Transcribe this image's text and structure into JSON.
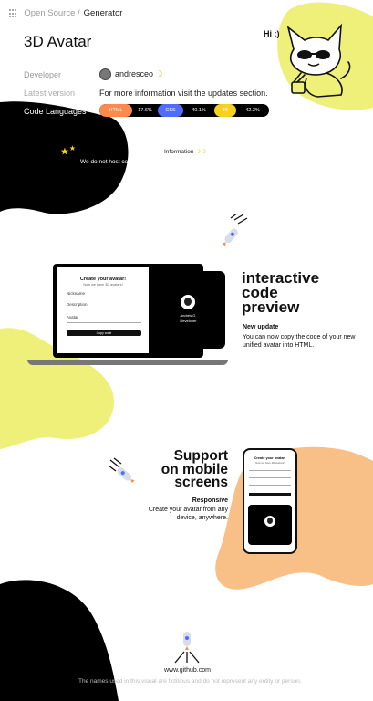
{
  "breadcrumb": {
    "parent": "Open Source /",
    "current": "Generator"
  },
  "page_title": "3D Avatar",
  "hi_text": "Hi :)",
  "details": {
    "developer_label": "Developer",
    "developer_value": "andresceo",
    "version_label": "Latest version",
    "version_value": "For more information visit the updates section.",
    "languages_label": "Code Languages"
  },
  "languages": [
    {
      "name": "HTML",
      "percent": "17.6%",
      "fraction": 0.176,
      "color": "#ff8a4c"
    },
    {
      "name": "CSS",
      "percent": "40.1%",
      "fraction": 0.401,
      "color": "#4f6cff"
    },
    {
      "name": "JS",
      "percent": "42.3%",
      "fraction": 0.423,
      "color": "#f5d31c"
    }
  ],
  "information": {
    "title": "Information",
    "text": "We do not host copyrighted images, use images that come from a trusted source."
  },
  "feature_preview": {
    "heading_lines": [
      "interactive",
      "code",
      "preview"
    ],
    "subheading": "New update",
    "text": "You can now copy the code of your new unified avatar into HTML."
  },
  "laptop_form": {
    "title": "Create your avatar!",
    "subtitle": "Now we have 3D avatars!",
    "field1": "Nickname",
    "field2": "Description",
    "field3": "Avatar",
    "button": "Copy code",
    "card_name": "Andrés G.",
    "card_role": "Developer"
  },
  "feature_mobile": {
    "heading_lines": [
      "Support",
      "on mobile",
      "screens"
    ],
    "subheading": "Responsive",
    "text": "Create your avatar from any device, anywhere."
  },
  "phone_form": {
    "title": "Create your avatar!",
    "subtitle": "Now we have 3D avatars!"
  },
  "footer": {
    "url": "www.github.com",
    "note": "The names used in this visual are fictitious and do not represent any entity or person."
  },
  "colors": {
    "yellow": "#eef07a",
    "peach": "#f8bf86",
    "black": "#000000"
  }
}
